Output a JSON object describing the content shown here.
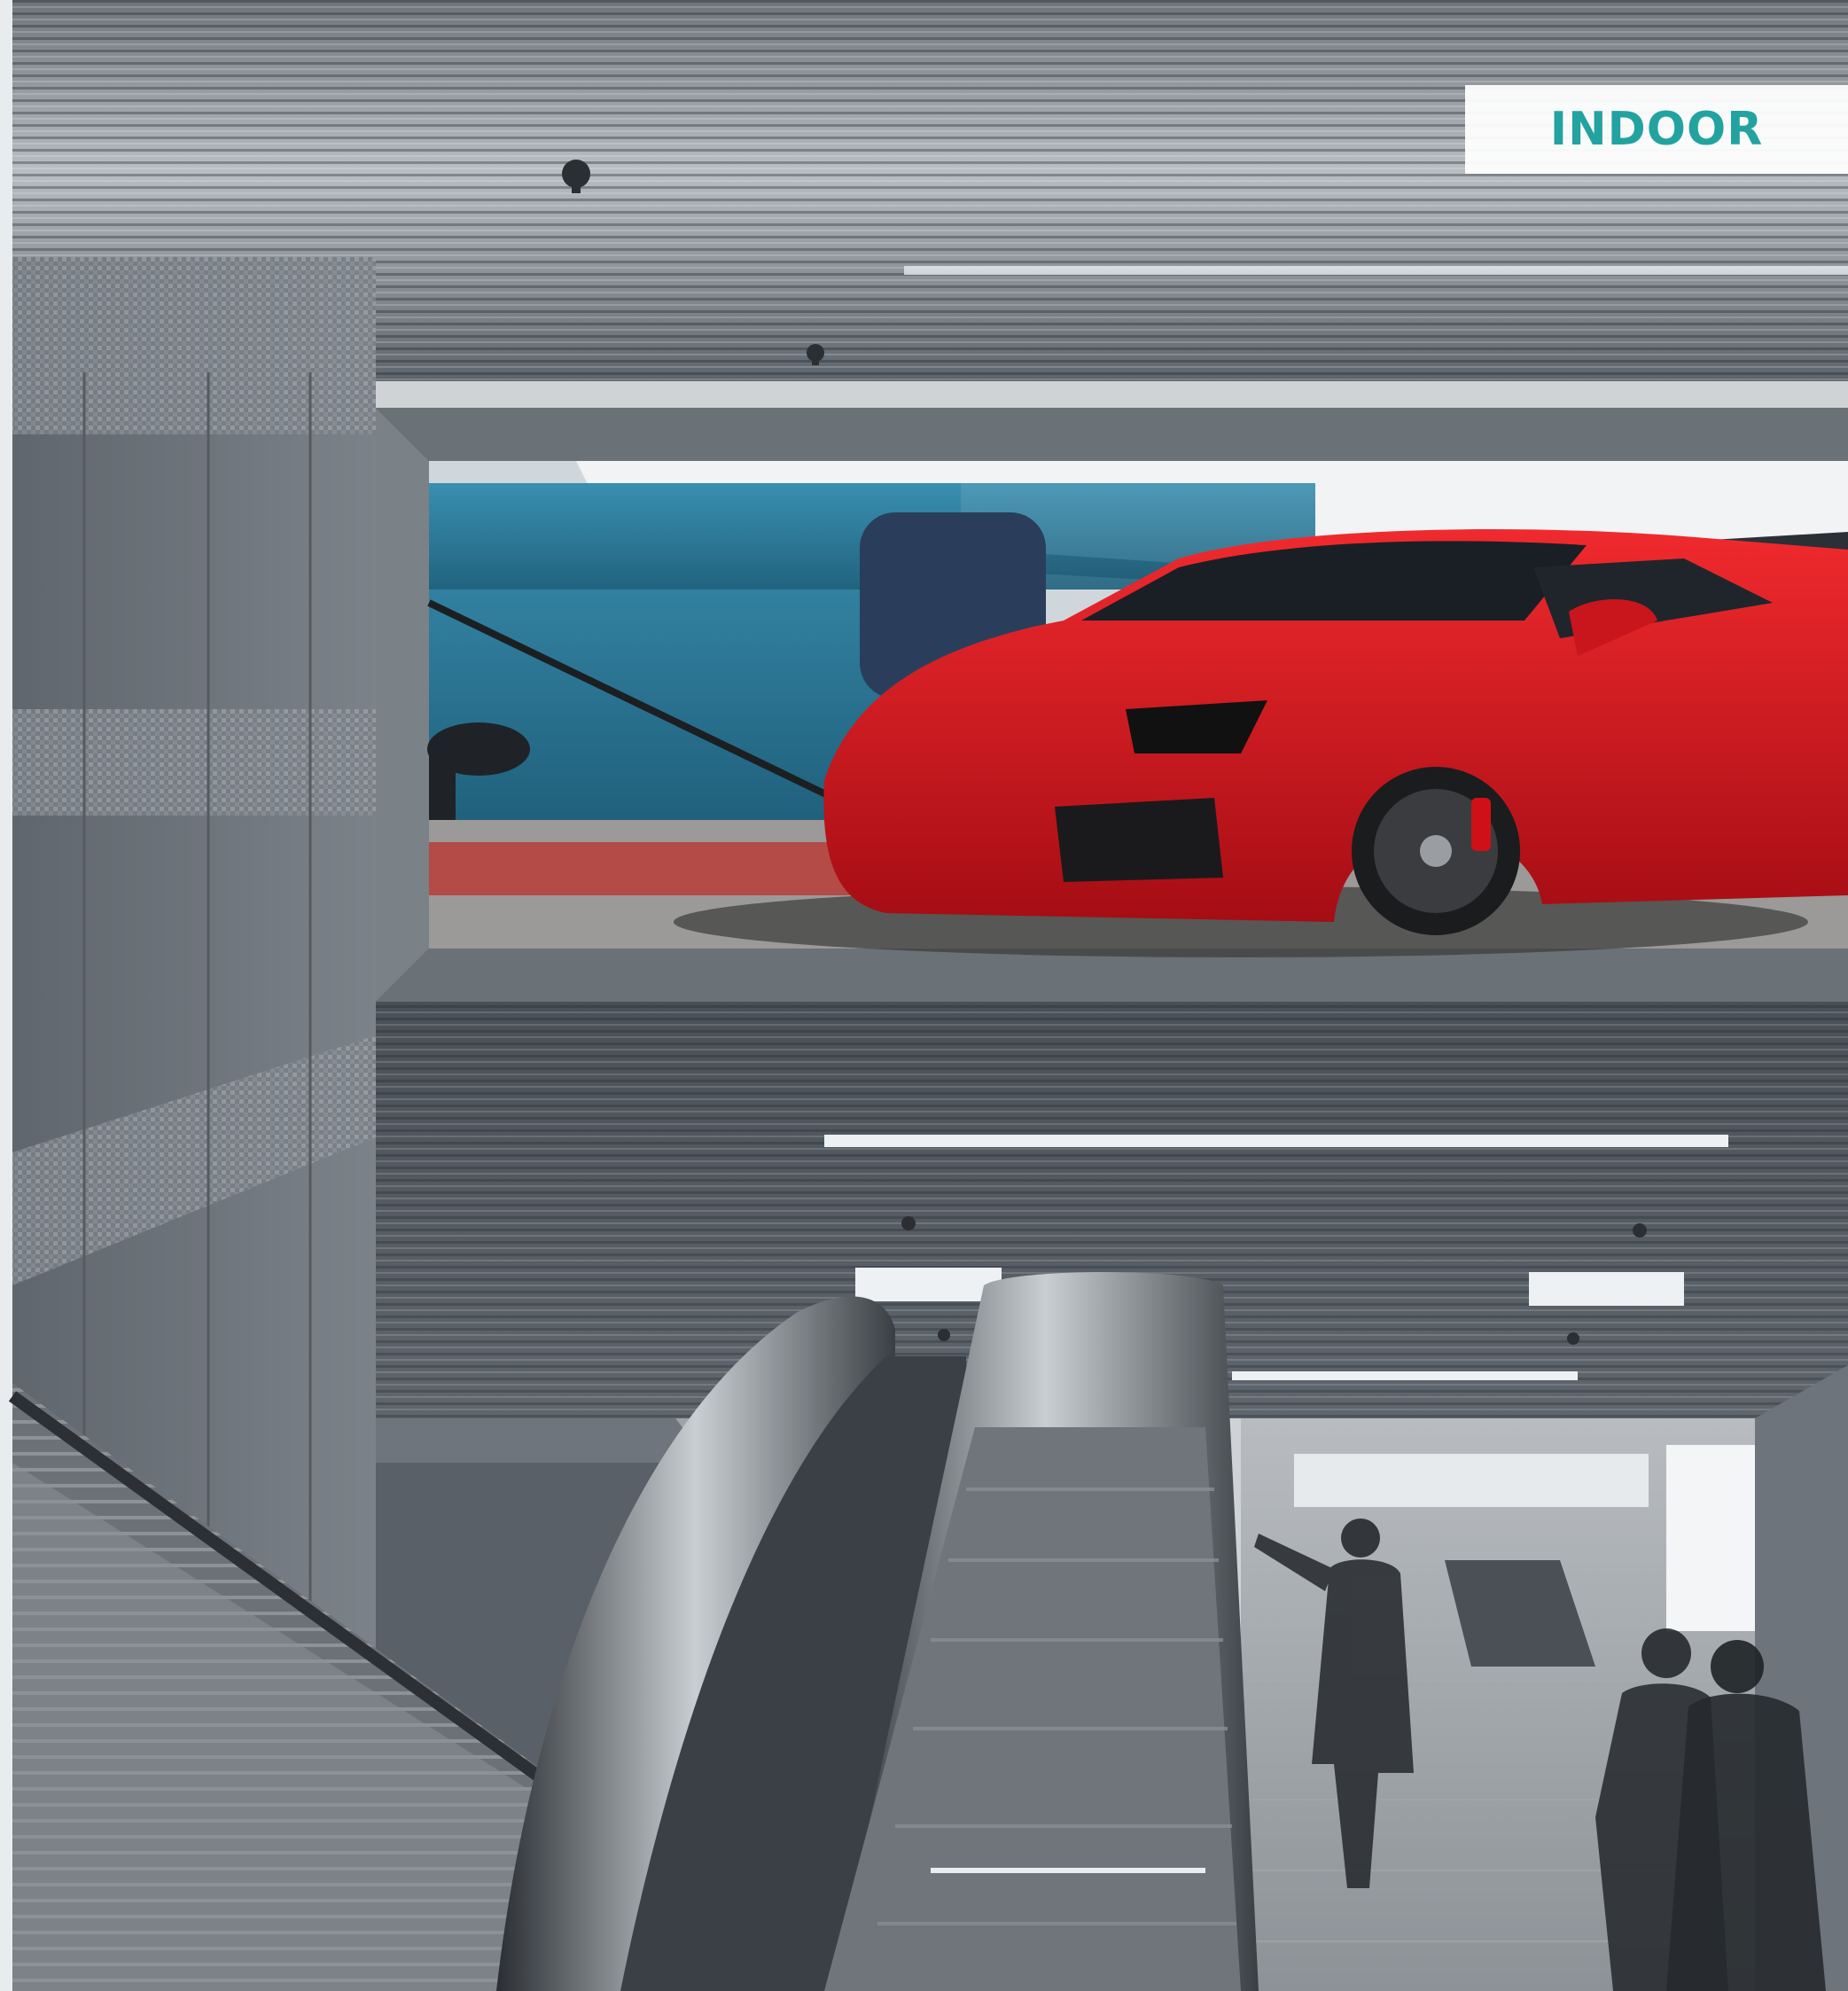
{
  "badge": {
    "text": "INDOOR",
    "color": "#23a3a0"
  },
  "scene": {
    "icons": [
      "sprinkler-icon",
      "car-icon",
      "escalator-icon",
      "person-icon"
    ],
    "colors": {
      "ceiling": "#9aa0a6",
      "wall": "#6d747b",
      "car": "#d8121b",
      "water": "#2f7f9e",
      "frame": "#5a6066"
    }
  }
}
